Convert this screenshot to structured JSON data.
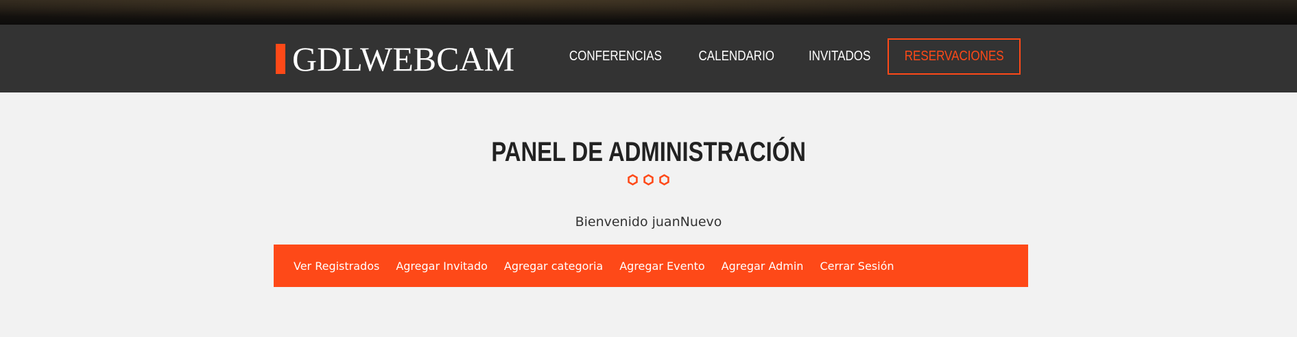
{
  "brand": {
    "logo_text": "GDLWEBCAM",
    "accent_color": "#fe4918"
  },
  "nav": {
    "items": [
      {
        "label": "CONFERENCIAS"
      },
      {
        "label": "CALENDARIO"
      },
      {
        "label": "INVITADOS"
      },
      {
        "label": "RESERVACIONES"
      }
    ]
  },
  "main": {
    "title": "PANEL DE ADMINISTRACIÓN",
    "divider_icon": "hexagon-icon",
    "welcome": "Bienvenido juanNuevo"
  },
  "admin_menu": {
    "items": [
      {
        "label": "Ver Registrados"
      },
      {
        "label": "Agregar Invitado"
      },
      {
        "label": "Agregar categoria"
      },
      {
        "label": "Agregar Evento"
      },
      {
        "label": "Agregar Admin"
      },
      {
        "label": "Cerrar Sesión"
      }
    ]
  }
}
